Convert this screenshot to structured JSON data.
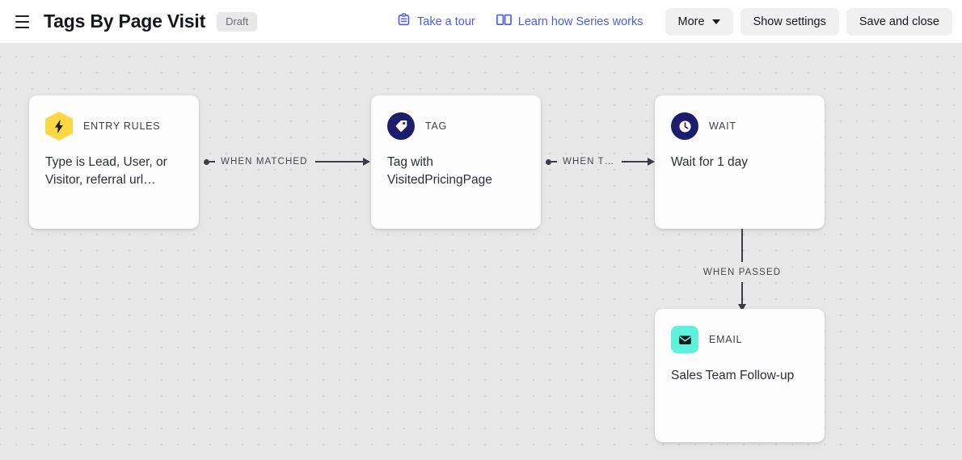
{
  "header": {
    "menu_icon": "hamburger-icon",
    "title": "Tags By Page Visit",
    "status": "Draft",
    "links": [
      {
        "icon": "clipboard-icon",
        "label": "Take a tour"
      },
      {
        "icon": "book-icon",
        "label": "Learn how Series works"
      }
    ],
    "buttons": [
      {
        "label": "More",
        "has_caret": true
      },
      {
        "label": "Show settings",
        "has_caret": false
      },
      {
        "label": "Save and close",
        "has_caret": false
      }
    ],
    "accent_color": "#4a5bf0"
  },
  "canvas": {
    "background_color": "#e8e8e8",
    "dot_color": "#d7d7d7",
    "nodes": [
      {
        "id": "entry-rules",
        "kind": "ENTRY RULES",
        "body": "Type is Lead, User, or Visitor, referral url…",
        "icon": "lightning-bolt-icon",
        "icon_shape": "hexagon",
        "icon_bg": "#fcd744",
        "icon_fg": "#1a1a1a"
      },
      {
        "id": "tag",
        "kind": "TAG",
        "body": "Tag with VisitedPricingPage",
        "icon": "tag-icon",
        "icon_shape": "circle",
        "icon_bg": "#1d1d6e",
        "icon_fg": "#ffffff"
      },
      {
        "id": "wait",
        "kind": "WAIT",
        "body": "Wait for 1 day",
        "icon": "clock-icon",
        "icon_shape": "circle",
        "icon_bg": "#1d1d6e",
        "icon_fg": "#ffffff"
      },
      {
        "id": "email",
        "kind": "EMAIL",
        "body": "Sales Team Follow-up",
        "icon": "envelope-icon",
        "icon_shape": "square",
        "icon_bg": "#5ef2dd",
        "icon_fg": "#15171c"
      }
    ],
    "connectors": [
      {
        "id": "entry-to-tag",
        "label": "WHEN MATCHED",
        "direction": "right"
      },
      {
        "id": "tag-to-wait",
        "label": "WHEN T…",
        "direction": "right"
      },
      {
        "id": "wait-to-email",
        "label": "WHEN PASSED",
        "direction": "down"
      }
    ]
  }
}
